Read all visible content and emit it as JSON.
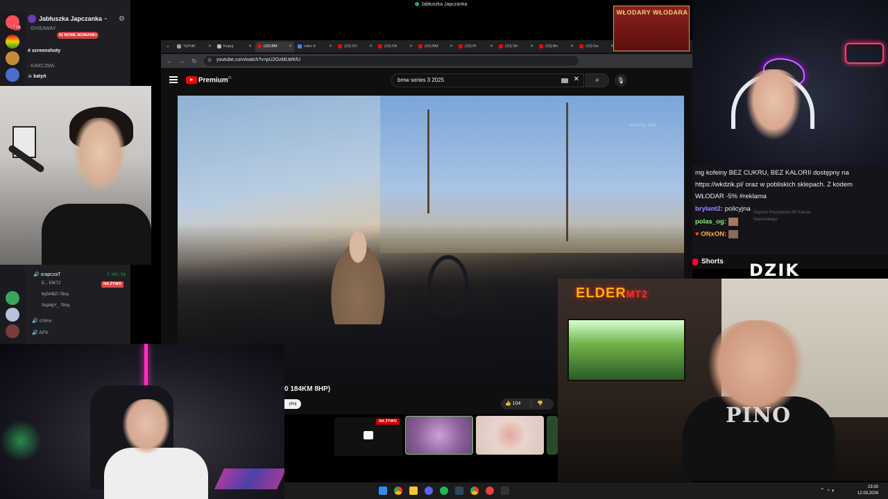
{
  "discord": {
    "server_name": "Jabłuszka Japczanka",
    "guild_badge": "716",
    "channels": [
      {
        "label": "GIVEAWAY",
        "active": false
      },
      {
        "label": "92 NOWE WZMIANKI",
        "active": false
      },
      {
        "label": "screenshoty",
        "active": true
      },
      {
        "label": "KARCZMA",
        "active": false
      },
      {
        "label": "katyń",
        "active": true
      }
    ],
    "voice_channel": "srapczaT",
    "voice_time": "7:02:59",
    "voice_users": [
      "E... EIKT2",
      "byDABZI 78sq",
      "SspidyY_ 78sq"
    ],
    "live_label": "NA ŻYWO",
    "other_channels": [
      "chlew",
      "AFK"
    ]
  },
  "topbar": {
    "title": "Jabłuszka Japczanka"
  },
  "browser": {
    "tabs": [
      "TqTvtK",
      "Kupuj",
      "(10) BM",
      "rolex d",
      "(10) SV",
      "(10) FA",
      "(10) BM",
      "(10) Pr",
      "(10) Sh",
      "(10) Bn",
      "(10) Ge"
    ],
    "url": "youtube.com/watch?v=pU2OzMLWKfU"
  },
  "youtube": {
    "brand": "Premium",
    "brand_suffix": "PL",
    "search_value": "bmw series 3 2025",
    "video_title": "0 184KM 8HP)",
    "subscribe_label": "ybuj",
    "like_count": "104",
    "live_label": "NA ŻYWO",
    "watermark": "NAPO NA"
  },
  "banner": {
    "text": "WŁODARY WŁODARA"
  },
  "chat": {
    "lines": [
      {
        "user": "",
        "text": "mg kofeiny BEZ CUKRU, BEZ KALORII dostępny na"
      },
      {
        "user": "",
        "text": "https://wkdzik.pl/ oraz w pobliskich sklepach. Z kodem"
      },
      {
        "user": "",
        "text": "WŁODAR -5% #reklama"
      },
      {
        "user": "brylant2:",
        "text": "policyjna"
      },
      {
        "user": "polas_og:",
        "text": ""
      },
      {
        "user": "ONxON:",
        "text": ""
      }
    ],
    "ghost_lines": [
      "Orędzie Prezydenta RP Karola",
      "Nawrockiego"
    ],
    "shorts_label": "Shorts",
    "dzik_logo": "DZIK"
  },
  "overlays": {
    "elder_sign": "ELDER",
    "elder_suffix": "MT2",
    "shirt_text": "PINO"
  },
  "taskbar": {
    "time": "23:30",
    "date": "12.03.2026"
  },
  "colors": {
    "discord_bg": "#1e1f22",
    "youtube_red": "#ff0000",
    "live_red": "#cc0000",
    "taskbar_bg": "#1c1c1c"
  }
}
